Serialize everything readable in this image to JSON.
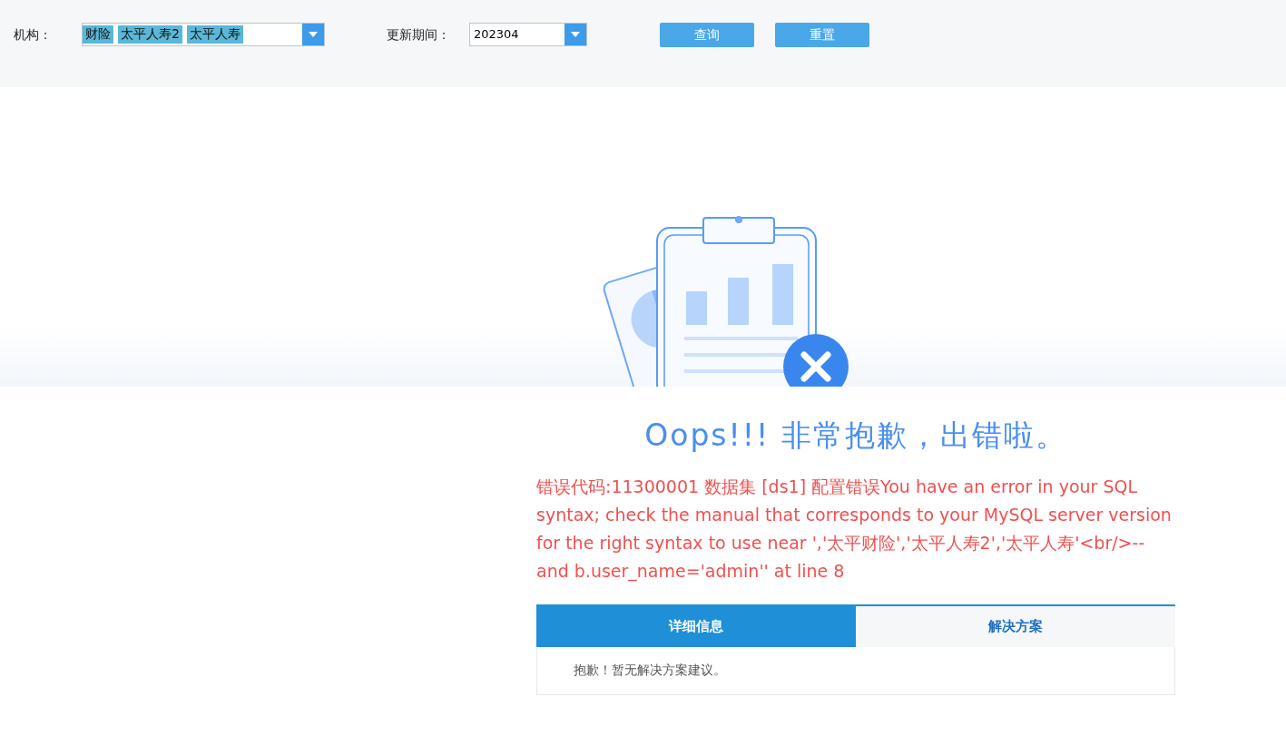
{
  "filters": {
    "org_label": "机构：",
    "org_tags": [
      "财险",
      "太平人寿2",
      "太平人寿"
    ],
    "period_label": "更新期间：",
    "period_value": "202304",
    "buttons": [
      "查询",
      "重置"
    ]
  },
  "error": {
    "title": "Oops!!! 非常抱歉，出错啦。",
    "message": "错误代码:11300001 数据集 [ds1] 配置错误You have an error in your SQL syntax; check the manual that corresponds to your MySQL server version for the right syntax to use near ','太平财险','太平人寿2','太平人寿'<br/>--and b.user_name='admin'' at line 8"
  },
  "tabs": [
    {
      "label": "详细信息",
      "selected": true
    },
    {
      "label": "解决方案",
      "selected": false
    }
  ],
  "tab_content": "抱歉！暂无解决方案建议。"
}
